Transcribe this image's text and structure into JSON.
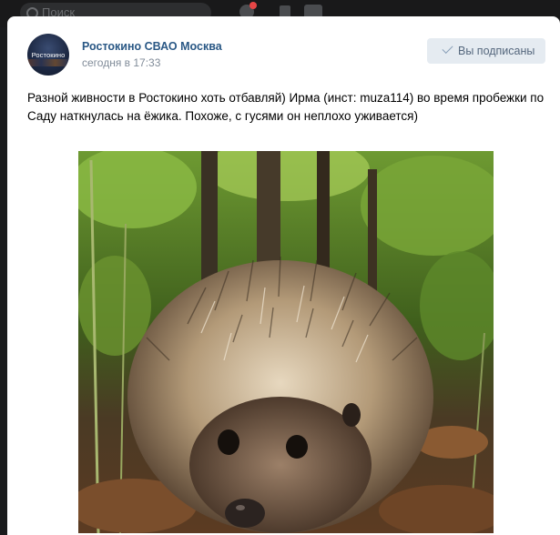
{
  "topbar": {
    "search_placeholder": "Поиск"
  },
  "post": {
    "avatar_text": "Ростокино",
    "author": "Ростокино СВАО Москва",
    "time": "сегодня в 17:33",
    "subscribe_button": "Вы подписаны",
    "text": "Разной живности в Ростокино хоть отбавляй) Ирма (инст: muza114) во время пробежки по Саду наткнулась на ёжика. Похоже, с гусями он неплохо уживается)",
    "photo_icon": "hedgehog-photo"
  },
  "colors": {
    "link": "#2a5885",
    "secondary": "#818c99",
    "button_bg": "#e5ebf1"
  }
}
